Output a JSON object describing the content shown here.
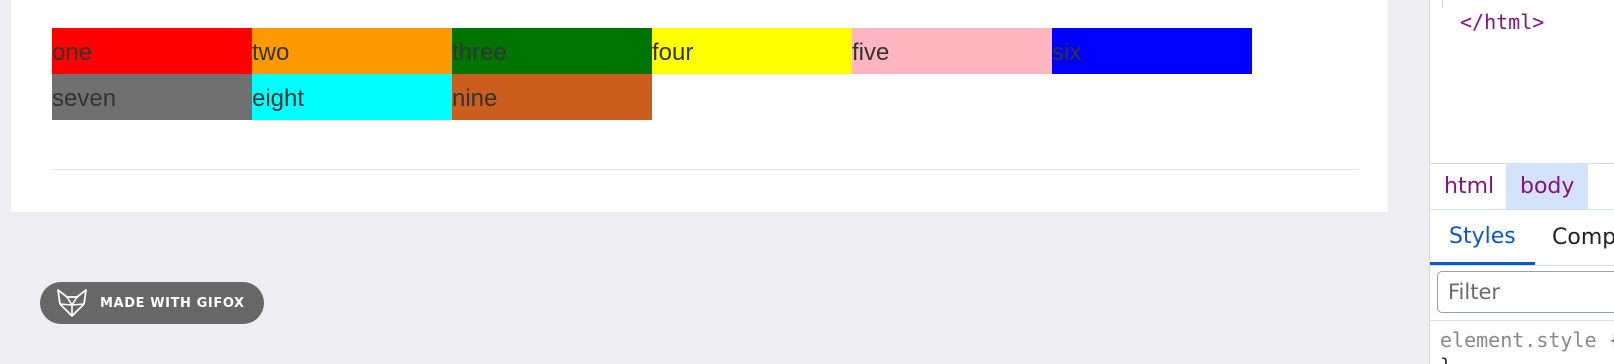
{
  "preview": {
    "cells": [
      {
        "label": "one",
        "color": "#ff0000"
      },
      {
        "label": "two",
        "color": "#ff9900"
      },
      {
        "label": "three",
        "color": "#007400"
      },
      {
        "label": "four",
        "color": "#ffff00"
      },
      {
        "label": "five",
        "color": "#ffb6c1"
      },
      {
        "label": "six",
        "color": "#0000ff"
      },
      {
        "label": "seven",
        "color": "#707070"
      },
      {
        "label": "eight",
        "color": "#00ffff"
      },
      {
        "label": "nine",
        "color": "#cb5e1c"
      }
    ]
  },
  "gifox": {
    "label": "MADE WITH GIFOX",
    "icon": "fox-icon"
  },
  "devtools": {
    "code_line": "</html>",
    "breadcrumbs": [
      "html",
      "body"
    ],
    "tabs": [
      "Styles",
      "Computed"
    ],
    "filter_placeholder": "Filter",
    "element_style": "element.style {",
    "closing_brace": "}"
  }
}
